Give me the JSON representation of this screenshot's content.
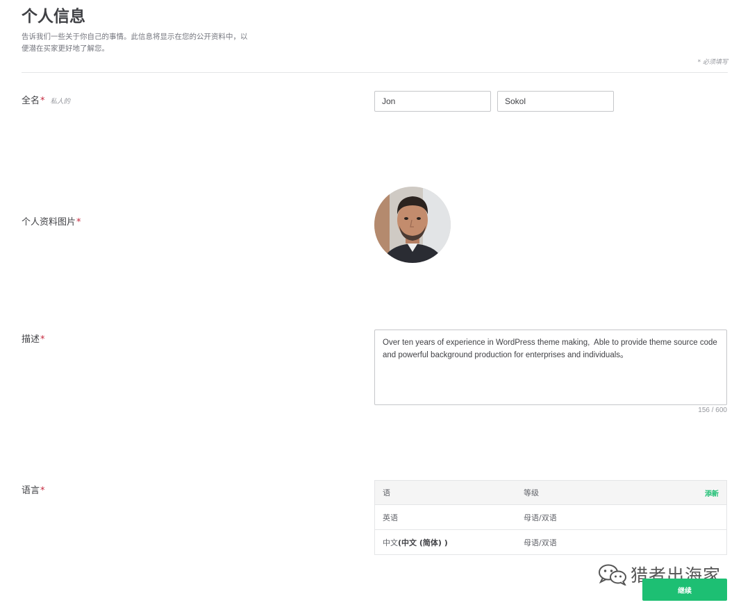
{
  "header": {
    "title": "个人信息",
    "intro_line1": "告诉我们一些关于你自己的事情。此信息将显示在您的公开资料中，以",
    "intro_line2": "便潜在买家更好地了解您。",
    "required_note": "* 必须填写"
  },
  "fullname": {
    "label": "全名",
    "required_mark": "*",
    "hint": "私人的",
    "first_name_value": "Jon",
    "last_name_value": "Sokol"
  },
  "profile_picture": {
    "label": "个人资料图片",
    "required_mark": "*"
  },
  "description": {
    "label": "描述",
    "required_mark": "*",
    "value": "Over ten years of experience in WordPress theme making,  Able to provide theme source code and powerful background production for enterprises and individuals。",
    "char_count": "156 / 600"
  },
  "languages": {
    "label": "语言",
    "required_mark": "*",
    "col_language": "语",
    "col_level": "等级",
    "add_new": "添新",
    "rows": [
      {
        "language": "英语",
        "language_suffix": "",
        "level": "母语/双语"
      },
      {
        "language": "中文",
        "language_suffix": "(中文 (简体) )",
        "level": "母语/双语"
      }
    ]
  },
  "watermark": {
    "text": "猎者出海家",
    "icon": "wechat-icon"
  },
  "footer": {
    "continue_label": "继续",
    "button_color": "#1dbf73"
  },
  "colors": {
    "accent": "#1dbf73",
    "required": "#c5283d"
  }
}
